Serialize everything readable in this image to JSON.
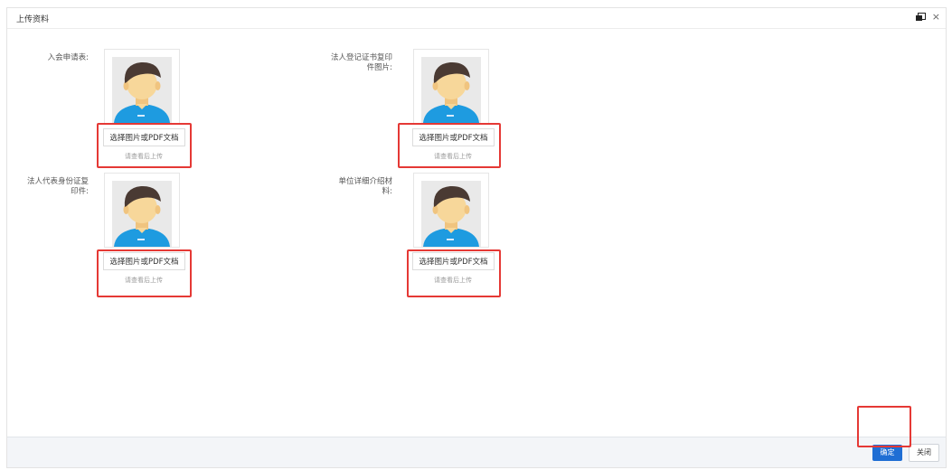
{
  "dialog": {
    "title": "上传资料",
    "icons": {
      "restore": "restore-window-icon",
      "close": "close-icon"
    },
    "close_glyph": "×"
  },
  "fields": [
    {
      "label_lines": [
        "入会申请表:"
      ],
      "button_label": "选择图片或PDF文档",
      "hint": "请查看后上传",
      "avatar_icon": "default-avatar-icon"
    },
    {
      "label_lines": [
        "法人登记证书复印",
        "件图片:"
      ],
      "button_label": "选择图片或PDF文档",
      "hint": "请查看后上传",
      "avatar_icon": "default-avatar-icon"
    },
    {
      "label_lines": [
        "法人代表身份证复",
        "印件:"
      ],
      "button_label": "选择图片或PDF文档",
      "hint": "请查看后上传",
      "avatar_icon": "default-avatar-icon"
    },
    {
      "label_lines": [
        "单位详细介绍材",
        "料:"
      ],
      "button_label": "选择图片或PDF文档",
      "hint": "请查看后上传",
      "avatar_icon": "default-avatar-icon"
    }
  ],
  "footer": {
    "ok_label": "确定",
    "close_label": "关闭"
  },
  "colors": {
    "highlight": "#e53935",
    "primary": "#1f6ed4",
    "avatar_shirt": "#1e9be0",
    "avatar_hair": "#4a3a33",
    "avatar_skin": "#f7d79a"
  }
}
